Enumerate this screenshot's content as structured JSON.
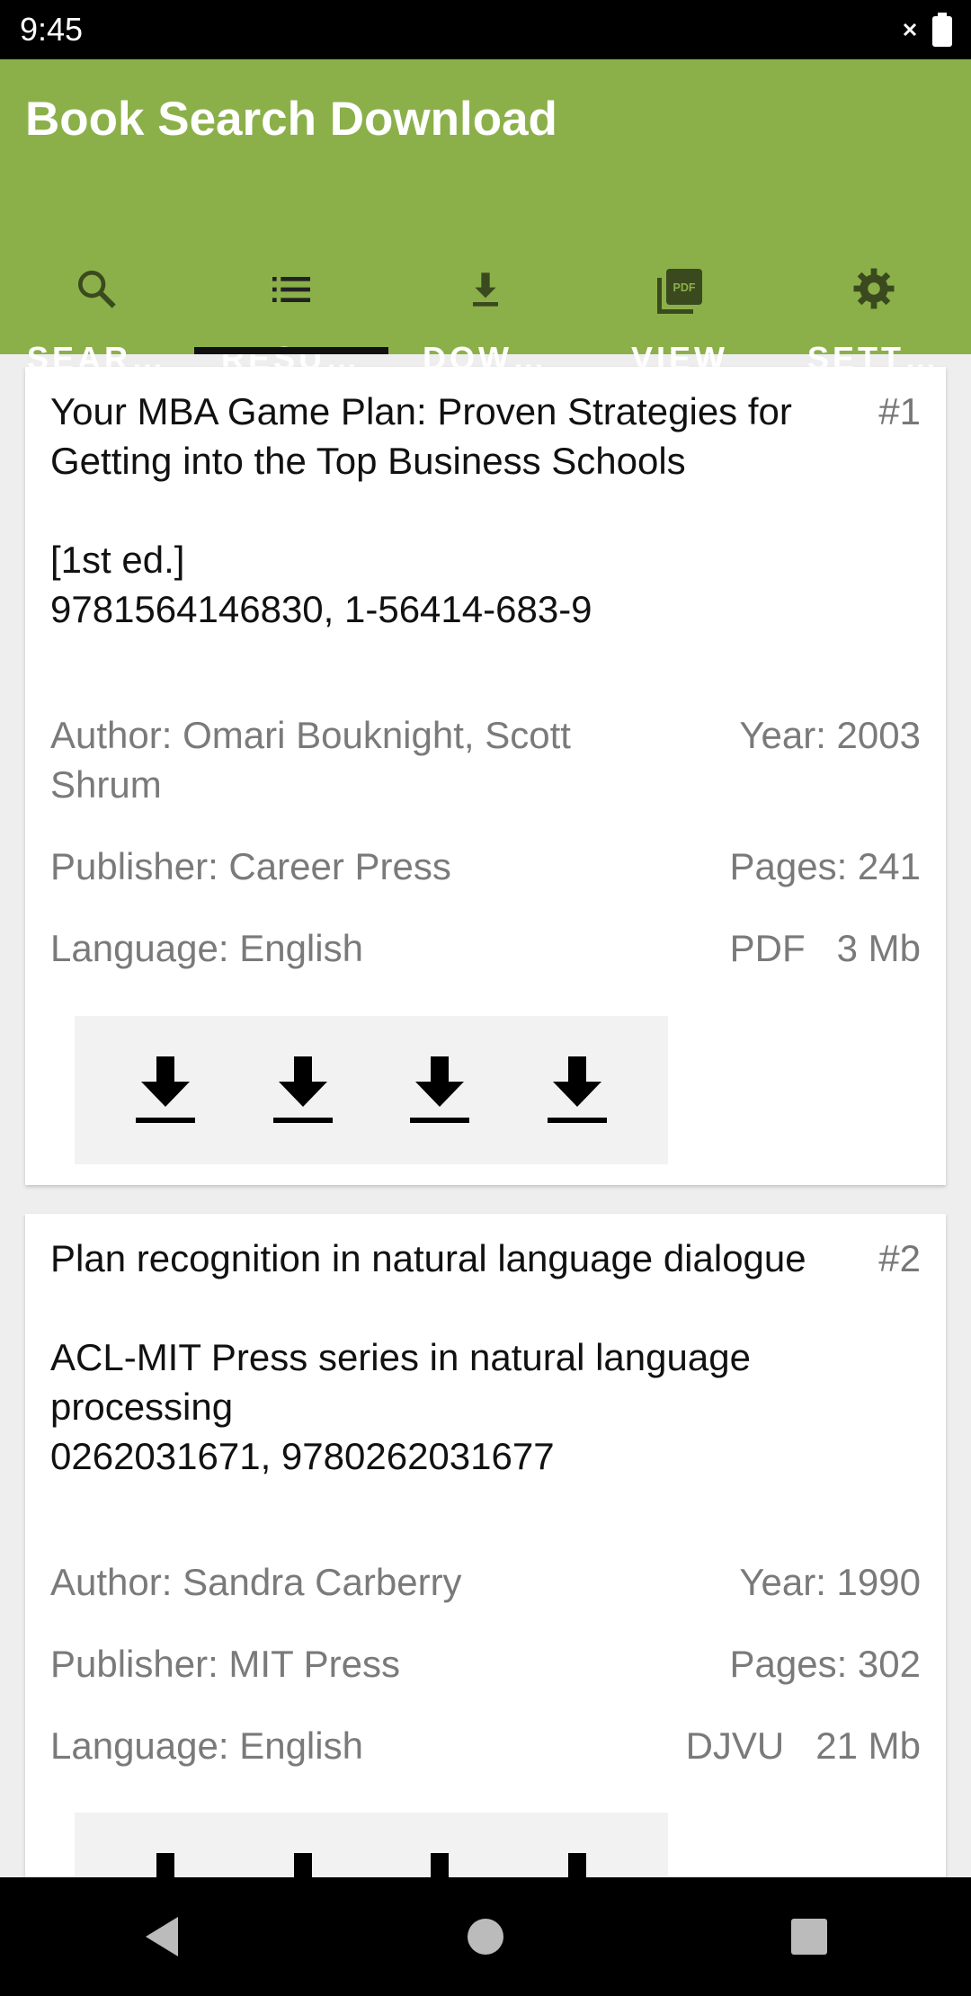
{
  "status_bar": {
    "time": "9:45"
  },
  "app": {
    "title": "Book Search Download"
  },
  "tabs": [
    {
      "label": "SEAR…",
      "icon": "search-icon"
    },
    {
      "label": "RESU…",
      "icon": "list-icon",
      "selected": true
    },
    {
      "label": "DOW…",
      "icon": "download-icon"
    },
    {
      "label": "VIEW",
      "icon": "pdf-icon"
    },
    {
      "label": "SETT…",
      "icon": "gear-icon"
    }
  ],
  "results": [
    {
      "title": "Your MBA Game Plan: Proven Strategies for Getting into the Top Business Schools\n\n[1st ed.]\n9781564146830, 1-56414-683-9",
      "number": "#1",
      "author": "Author: Omari Bouknight, Scott Shrum",
      "year": "Year: 2003",
      "publisher": "Publisher: Career Press",
      "pages": "Pages: 241",
      "language": "Language: English",
      "format": "PDF",
      "size": "3 Mb"
    },
    {
      "title": "Plan recognition in natural language dialogue\n\nACL-MIT Press series in natural language processing\n0262031671, 9780262031677",
      "number": "#2",
      "author": "Author: Sandra Carberry",
      "year": "Year: 1990",
      "publisher": "Publisher: MIT Press",
      "pages": "Pages: 302",
      "language": "Language: English",
      "format": "DJVU",
      "size": "21 Mb"
    }
  ],
  "colors": {
    "app_bar": "#8bb04a",
    "icon_dark": "#3b4a1e"
  }
}
